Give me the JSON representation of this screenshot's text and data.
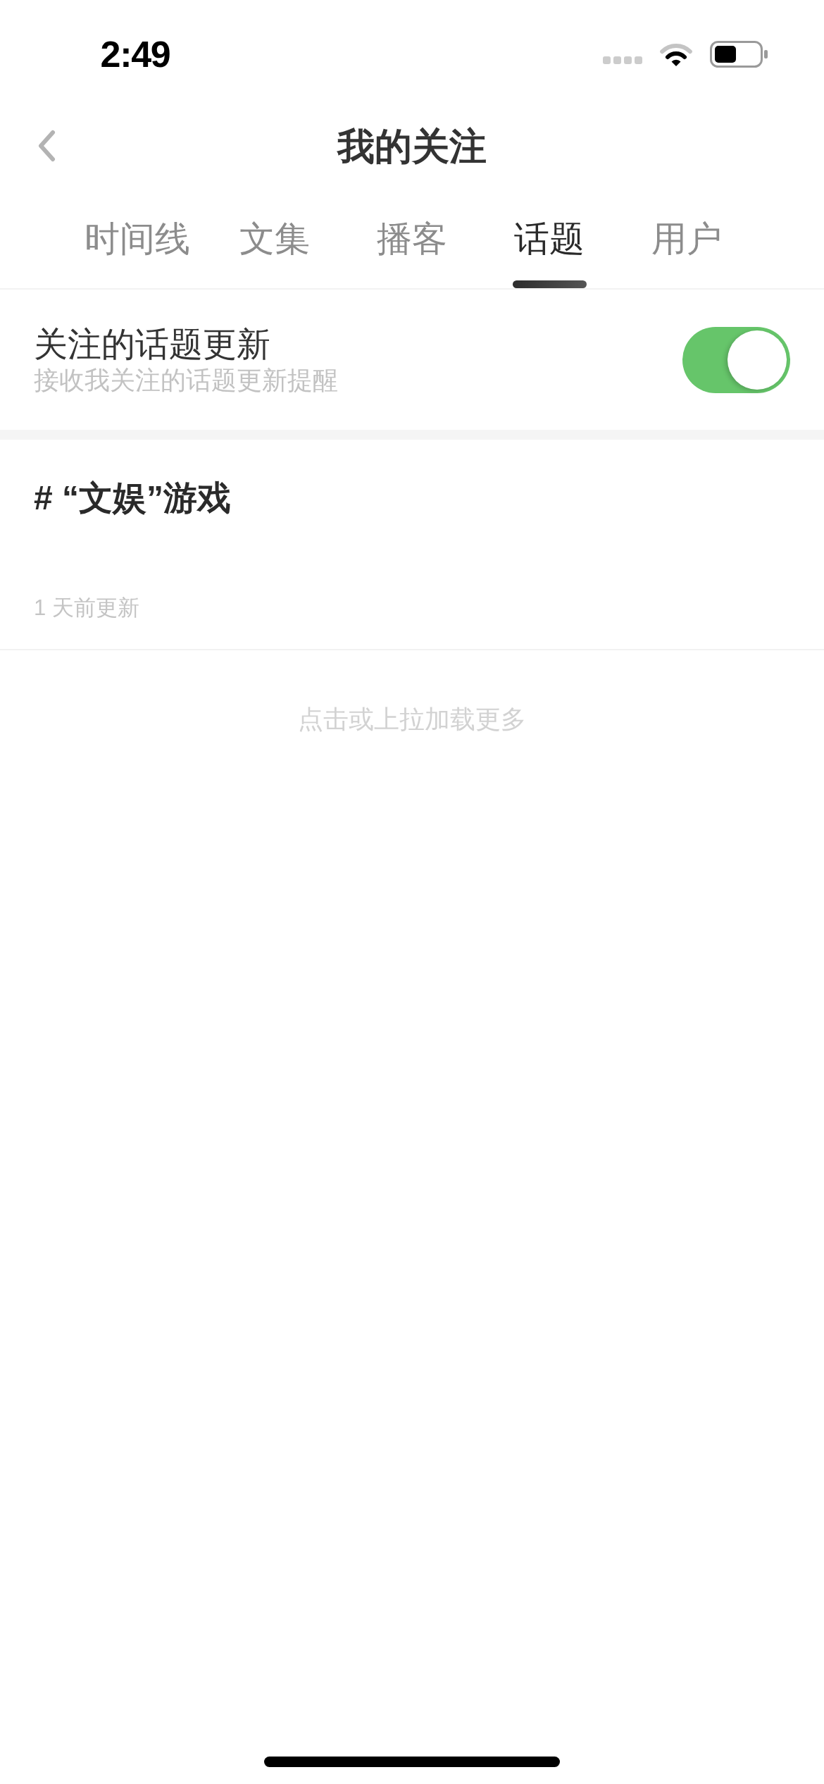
{
  "status_bar": {
    "time": "2:49"
  },
  "nav_bar": {
    "title": "我的关注"
  },
  "tabs": [
    {
      "label": "时间线",
      "selected": false
    },
    {
      "label": "文集",
      "selected": false
    },
    {
      "label": "播客",
      "selected": false
    },
    {
      "label": "话题",
      "selected": true
    },
    {
      "label": "用户",
      "selected": false
    }
  ],
  "topic_updates_setting": {
    "title": "关注的话题更新",
    "subtitle": "接收我关注的话题更新提醒",
    "on": true
  },
  "topics": [
    {
      "title": "# “文娱”游戏",
      "updated": "1 天前更新"
    }
  ],
  "load_more": "点击或上拉加载更多"
}
